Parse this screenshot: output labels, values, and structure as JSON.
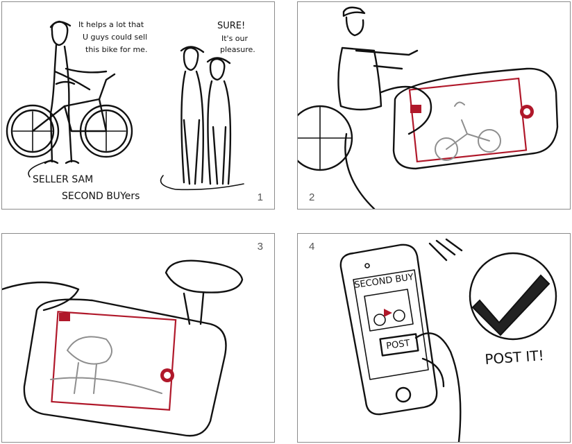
{
  "panels": [
    {
      "number": "1",
      "speech_seller": [
        "It helps a lot that",
        "U guys could sell",
        "this bike for me."
      ],
      "speech_buyers": [
        "SURE!",
        "It's our",
        "pleasure."
      ],
      "label_seller": "SELLER SAM",
      "label_buyers": "SECOND BUYers"
    },
    {
      "number": "2"
    },
    {
      "number": "3"
    },
    {
      "number": "4",
      "app_title": "SECOND BUY",
      "post_button": "POST",
      "caption": "POST IT!"
    }
  ],
  "colors": {
    "frame": "#8a8a8a",
    "ink": "#111111",
    "record_red": "#b0182a",
    "sketch_grey": "#8e8e8e"
  }
}
